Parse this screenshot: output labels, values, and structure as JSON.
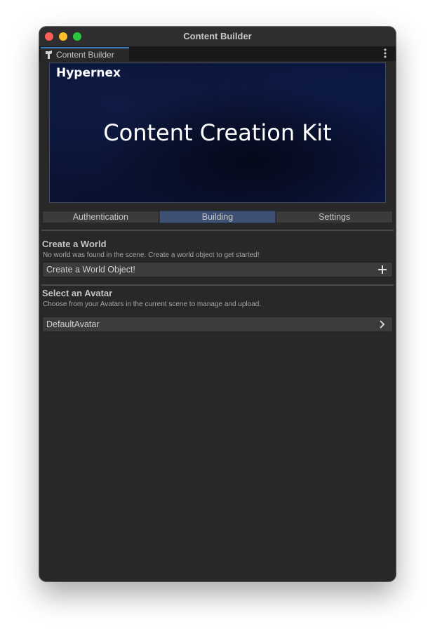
{
  "window": {
    "title": "Content Builder"
  },
  "tab": {
    "label": "Content Builder",
    "icon": "hammer-icon"
  },
  "banner": {
    "brand": "Hypernex",
    "title": "Content Creation Kit"
  },
  "tabs": [
    {
      "label": "Authentication",
      "active": false
    },
    {
      "label": "Building",
      "active": true
    },
    {
      "label": "Settings",
      "active": false
    }
  ],
  "world": {
    "title": "Create a World",
    "description": "No world was found in the scene. Create a world object to get started!",
    "button_label": "Create a World Object!",
    "button_icon": "plus-icon"
  },
  "avatar": {
    "title": "Select an Avatar",
    "description": "Choose from your Avatars in the current scene to manage and upload.",
    "item_label": "DefaultAvatar",
    "item_icon": "chevron-right-icon"
  },
  "colors": {
    "active_tab": "#3e5174",
    "tab_accent": "#3a79bb",
    "close": "#fe5f57",
    "minimize": "#febc2e",
    "maximize": "#28c840"
  }
}
